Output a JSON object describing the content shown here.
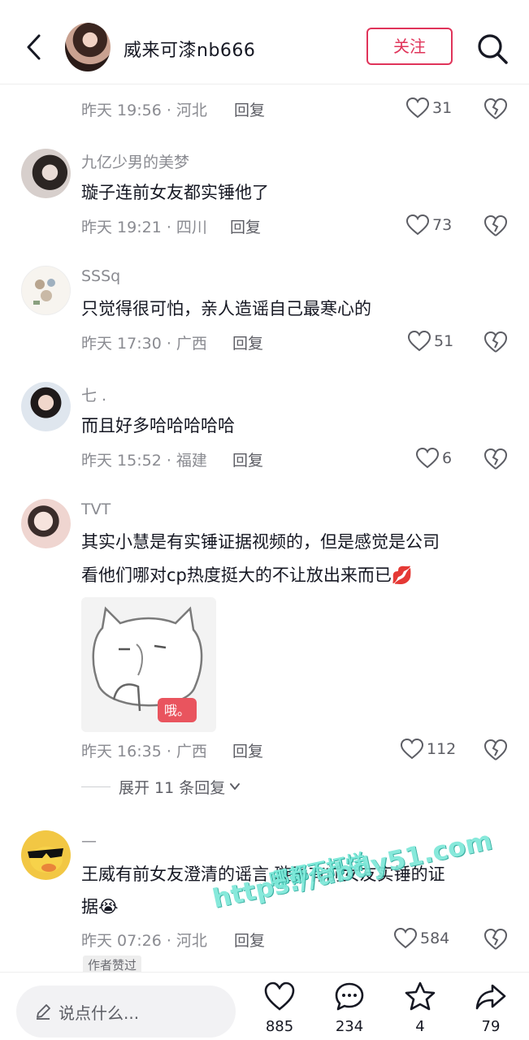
{
  "header": {
    "name": "威来可漆nb666",
    "follow_label": "关注"
  },
  "comments": [
    {
      "time_loc": "昨天 19:56 · 河北",
      "reply_label": "回复",
      "likes": "31"
    },
    {
      "username": "九亿少男的美梦",
      "text": "璇子连前女友都实锤他了",
      "time_loc": "昨天 19:21 · 四川",
      "reply_label": "回复",
      "likes": "73"
    },
    {
      "username": "SSSq",
      "text": "只觉得很可怕，亲人造谣自己最寒心的",
      "time_loc": "昨天 17:30 · 广西",
      "reply_label": "回复",
      "likes": "51"
    },
    {
      "username": "七 .",
      "text": "而且好多哈哈哈哈哈",
      "time_loc": "昨天 15:52 · 福建",
      "reply_label": "回复",
      "likes": "6"
    },
    {
      "username": "TVT",
      "text_line1": "其实小慧是有实锤证据视频的，但是感觉是公司",
      "text_line2": "看他们哪对cp热度挺大的不让放出来而已",
      "emoji": "💋",
      "sticker_label": "哦。",
      "time_loc": "昨天 16:35 · 广西",
      "reply_label": "回复",
      "likes": "112",
      "expand_label": "展开 11 条回复"
    },
    {
      "username": "—",
      "text_line1": "王威有前女友澄清的谣言 璇子有前女友实锤的证",
      "text_line2": "据",
      "emoji": "😭",
      "time_loc": "昨天 07:26 · 河北",
      "reply_label": "回复",
      "likes": "584",
      "badge": "作者赞过"
    }
  ],
  "watermark": {
    "line1": "哪都不打烊",
    "line2": "https://abdy51.com"
  },
  "bottom_bar": {
    "input_placeholder": "说点什么...",
    "like_count": "885",
    "comment_count": "234",
    "favorite_count": "4",
    "share_count": "79"
  },
  "colors": {
    "accent": "#e0345a",
    "secondary_text": "#8a8b91",
    "primary_text": "#161823"
  }
}
